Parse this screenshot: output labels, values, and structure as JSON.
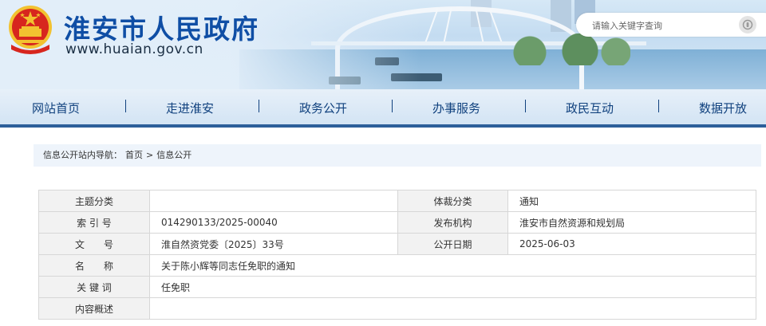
{
  "header": {
    "title": "淮安市人民政府",
    "url": "www.huaian.gov.cn",
    "search_placeholder": "请输入关键字查询"
  },
  "nav": [
    "网站首页",
    "走进淮安",
    "政务公开",
    "办事服务",
    "政民互动",
    "数据开放"
  ],
  "breadcrumb": {
    "label": "信息公开站内导航：",
    "home": "首页",
    "separator": ">",
    "current": "信息公开"
  },
  "info": {
    "topic_label": "主题分类",
    "topic_value": "",
    "genre_label": "体裁分类",
    "genre_value": "通知",
    "index_label": "索 引 号",
    "index_value": "014290133/2025-00040",
    "issuer_label": "发布机构",
    "issuer_value": "淮安市自然资源和规划局",
    "docno_label": "文　　号",
    "docno_value": "淮自然资党委〔2025〕33号",
    "date_label": "公开日期",
    "date_value": "2025-06-03",
    "name_label": "名　　称",
    "name_value": "关于陈小辉等同志任免职的通知",
    "keyword_label": "关 键 词",
    "keyword_value": "任免职",
    "summary_label": "内容概述",
    "summary_value": ""
  },
  "colors": {
    "brand_blue": "#0f4ea5",
    "nav_text": "#10417e",
    "nav_border": "#2c5f9a",
    "emblem_red": "#d7261e",
    "emblem_gold": "#f2c230"
  }
}
